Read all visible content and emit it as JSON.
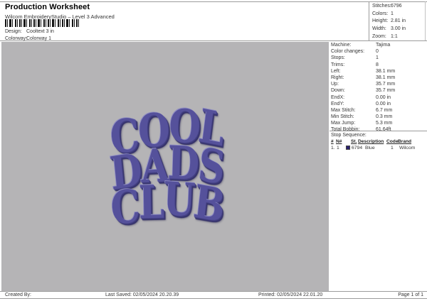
{
  "header": {
    "title": "Production Worksheet",
    "subtitle": "Wilcom EmbroideryStudio – Level 3 Advanced",
    "design_label": "Design:",
    "design_value": "Cooltext 3 in",
    "colorway_label": "Colorway:",
    "colorway_value": "Colorway 1"
  },
  "stats_box": {
    "rows": [
      {
        "label": "Stitches:",
        "value": "6796"
      },
      {
        "label": "Colors:",
        "value": "1"
      },
      {
        "label": "Height:",
        "value": "2.81 in"
      },
      {
        "label": "Width:",
        "value": "3.00 in"
      },
      {
        "label": "Zoom:",
        "value": "1:1"
      }
    ]
  },
  "canvas": {
    "design_lines": [
      "COOL",
      "DADS",
      "CLUB"
    ],
    "thread_color": "#55519b",
    "background_color": "#b5b4b6"
  },
  "machine_panel": {
    "rows": [
      {
        "label": "Machine:",
        "value": "Tajima"
      },
      {
        "label": "Color changes:",
        "value": "0"
      },
      {
        "label": "Stops:",
        "value": "1"
      },
      {
        "label": "Trims:",
        "value": "8"
      },
      {
        "label": "Left:",
        "value": "38.1 mm"
      },
      {
        "label": "Right:",
        "value": "38.1 mm"
      },
      {
        "label": "Up:",
        "value": "35.7 mm"
      },
      {
        "label": "Down:",
        "value": "35.7 mm"
      },
      {
        "label": "EndX:",
        "value": "0.00 in"
      },
      {
        "label": "EndY:",
        "value": "0.00 in"
      },
      {
        "label": "Max Stitch:",
        "value": "6.7 mm"
      },
      {
        "label": "Min Stitch:",
        "value": "0.3 mm"
      },
      {
        "label": "Max Jump:",
        "value": "5.3 mm"
      },
      {
        "label": "Total Bobbin:",
        "value": "61.64ft"
      }
    ],
    "stop_sequence": {
      "title": "Stop Sequence:",
      "columns": {
        "num": "#",
        "n": "N#",
        "st": "St.",
        "description": "Description",
        "code": "Code",
        "brand": "Brand"
      },
      "rows": [
        {
          "num": "1.",
          "n": "1",
          "swatch_color": "#29216e",
          "st": "6794",
          "description": "Blue",
          "code": "1",
          "brand": "Wilcom"
        }
      ]
    }
  },
  "footer": {
    "created_by": "Created By:",
    "last_saved": "Last Saved: 02/05/2024 20.20.39",
    "printed": "Printed: 02/05/2024 22.01.20",
    "page": "Page 1 of 1"
  }
}
